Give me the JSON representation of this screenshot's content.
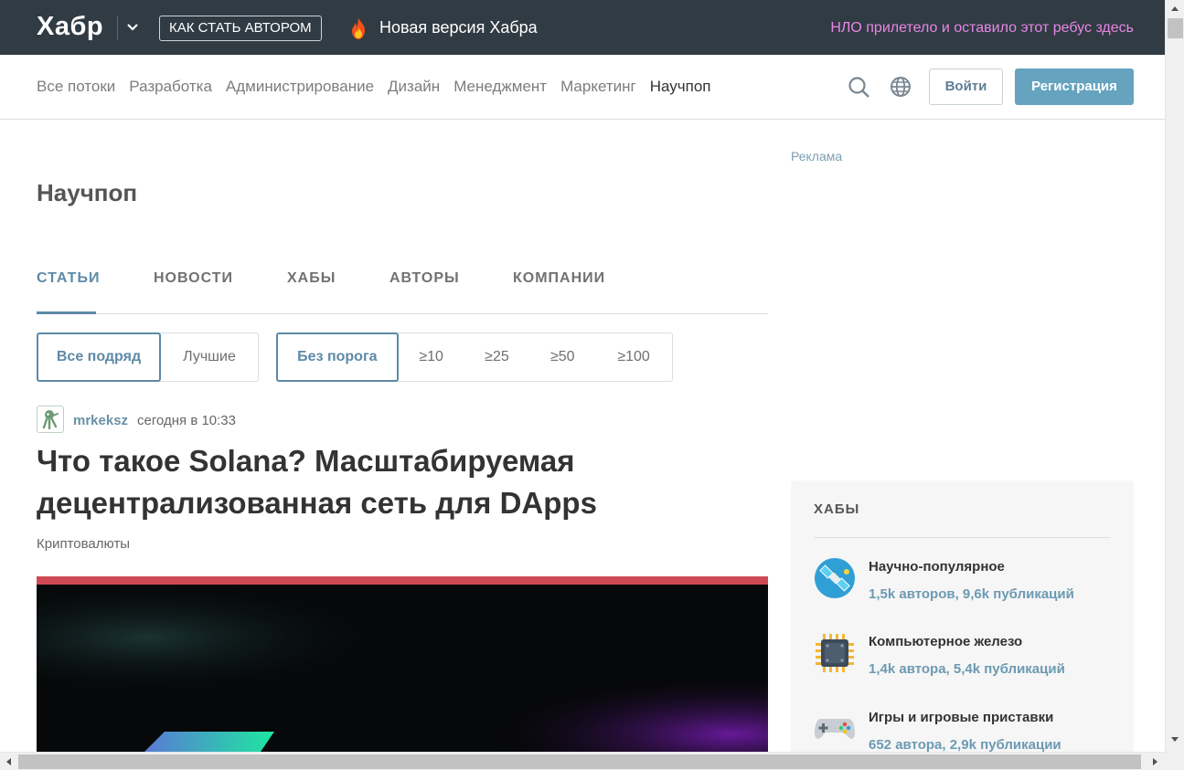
{
  "topbar": {
    "logo": "Хабр",
    "author_btn": "КАК СТАТЬ АВТОРОМ",
    "new_version": "Новая версия Хабра",
    "ufo_link": "НЛО прилетело и оставило этот ребус здесь"
  },
  "nav": {
    "items": [
      "Все потоки",
      "Разработка",
      "Администрирование",
      "Дизайн",
      "Менеджмент",
      "Маркетинг",
      "Научпоп"
    ],
    "active": "Научпоп",
    "login": "Войти",
    "register": "Регистрация"
  },
  "page": {
    "title": "Научпоп",
    "tabs": [
      "СТАТЬИ",
      "НОВОСТИ",
      "ХАБЫ",
      "АВТОРЫ",
      "КОМПАНИИ"
    ],
    "active_tab": "СТАТЬИ",
    "filters_sort": [
      "Все подряд",
      "Лучшие"
    ],
    "filters_threshold": [
      "Без порога",
      "≥10",
      "≥25",
      "≥50",
      "≥100"
    ]
  },
  "post": {
    "author": "mrkeksz",
    "time": "сегодня в 10:33",
    "title": "Что такое Solana? Масштабируемая децентрализованная сеть для DApps",
    "hub": "Криптовалюты"
  },
  "sidebar": {
    "ad_label": "Реклама",
    "hubs_title": "ХАБЫ",
    "hubs": [
      {
        "name": "Научно-популярное",
        "stats": "1,5k авторов, 9,6k публикаций",
        "icon": "satellite-icon"
      },
      {
        "name": "Компьютерное железо",
        "stats": "1,4k автора, 5,4k публикаций",
        "icon": "chip-icon"
      },
      {
        "name": "Игры и игровые приставки",
        "stats": "652 автора, 2,9k публикации",
        "icon": "gamepad-icon"
      }
    ]
  },
  "colors": {
    "topbar_bg": "#303b44",
    "accent": "#5e8aa7",
    "register_bg": "#65a3be",
    "ufo_link": "#e986e4"
  }
}
